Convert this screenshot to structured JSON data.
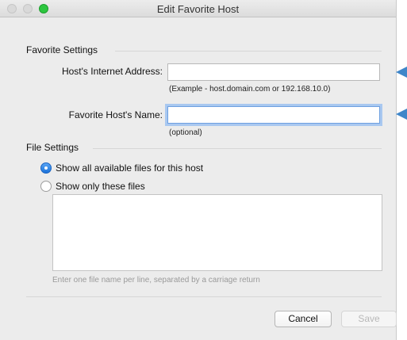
{
  "window": {
    "title": "Edit Favorite Host"
  },
  "favorite_settings": {
    "section_title": "Favorite Settings",
    "address_label": "Host's Internet Address:",
    "address_value": "",
    "address_hint": "(Example - host.domain.com or 192.168.10.0)",
    "name_label": "Favorite Host's Name:",
    "name_value": "",
    "name_hint": "(optional)"
  },
  "file_settings": {
    "section_title": "File Settings",
    "options": [
      {
        "label": "Show all available files for this host",
        "selected": true
      },
      {
        "label": "Show only these files",
        "selected": false
      }
    ],
    "files_value": "",
    "note": "Enter one file name per line, separated by a carriage return"
  },
  "buttons": {
    "cancel": "Cancel",
    "save": "Save"
  },
  "colors": {
    "accent": "#1b72d9",
    "zoom_light": "#2dc63f",
    "pointer_arrow": "#3f86c9"
  }
}
